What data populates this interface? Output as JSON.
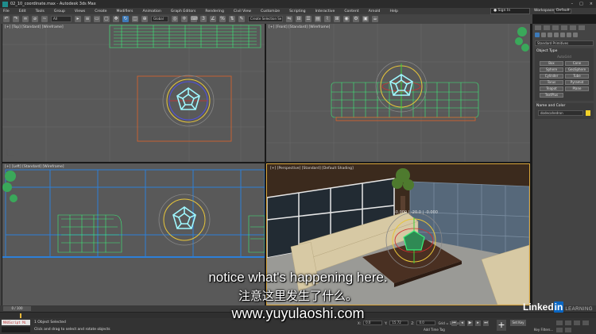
{
  "app": {
    "window_title": "02_10_coordinate.max - Autodesk 3ds Max",
    "window_controls": [
      "–",
      "□",
      "×"
    ]
  },
  "menu": {
    "items": [
      "File",
      "Edit",
      "Tools",
      "Group",
      "Views",
      "Create",
      "Modifiers",
      "Animation",
      "Graph Editors",
      "Rendering",
      "Civil View",
      "Customize",
      "Scripting",
      "Interactive",
      "Content",
      "Arnold",
      "Help"
    ],
    "sign_in": "Sign In",
    "workspaces_label": "Workspaces:",
    "workspaces_value": "Default"
  },
  "toolbar": {
    "filter_dropdown": "All",
    "reference_dropdown": "Global",
    "selection_set": "Create Selection Se"
  },
  "viewports": {
    "top": "[+] [Top] [Standard] [Wireframe]",
    "front": "[+] [Front] [Standard] [Wireframe]",
    "left": "[+] [Left] [Standard] [Wireframe]",
    "perspective": "[+] [Perspective] [Standard] [Default Shading]",
    "gizmo_readout": "-0.000 | -20.0 | -0.000"
  },
  "command_panel": {
    "category_dropdown": "Standard Primitives",
    "object_type_header": "Object Type",
    "autogrid_label": "AutoGrid",
    "objects": [
      "Box",
      "Cone",
      "Sphere",
      "GeoSphere",
      "Cylinder",
      "Tube",
      "Torus",
      "Pyramid",
      "Teapot",
      "Plane",
      "TextPlus"
    ],
    "name_color_header": "Name and Color",
    "object_name": "dodecahedron",
    "object_color": "#f4d229"
  },
  "timeline": {
    "frame_indicator": "0 / 100"
  },
  "status": {
    "maxscript_label": "MAXScript Mi",
    "selection_status": "1 Object Selected",
    "prompt": "Click and drag to select and rotate objects",
    "x_label": "X:",
    "x_value": "0.0",
    "y_label": "Y:",
    "y_value": "15.72",
    "z_label": "Z:",
    "z_value": "0.0",
    "grid_label": "Grid = 10.0cm",
    "add_time_tag": "Add Time Tag",
    "set_key": "Set Key",
    "key_filters": "Key Filters..."
  },
  "branding": {
    "linkedin_text": "Linked",
    "linkedin_in": "in",
    "learning": "LEARNING"
  },
  "subtitles": {
    "english": "notice what's happening here.",
    "chinese": "注意这里发生了什么。",
    "url": "www.yuyulaoshi.com"
  }
}
